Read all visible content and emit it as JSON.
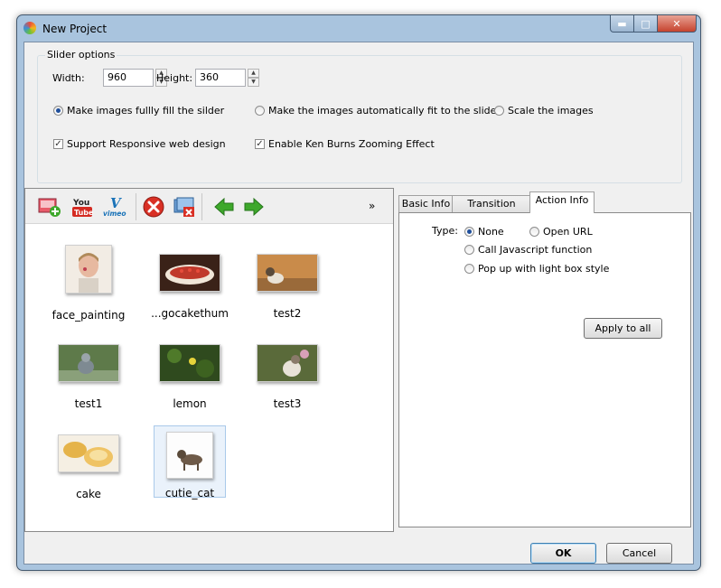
{
  "window": {
    "title": "New Project"
  },
  "slider_options": {
    "legend": "Slider options",
    "width_label": "Width:",
    "width_value": "960",
    "height_label": "Height:",
    "height_value": "360",
    "fill_modes": [
      {
        "label": "Make images fullly fill the silder",
        "selected": true
      },
      {
        "label": "Make the images automatically fit to the slider",
        "selected": false
      },
      {
        "label": "Scale the images",
        "selected": false
      }
    ],
    "responsive_label": "Support Responsive web design",
    "responsive_checked": true,
    "kenburns_label": "Enable Ken Burns Zooming Effect",
    "kenburns_checked": true
  },
  "toolbar": {
    "youtube_top": "You",
    "youtube_bottom": "Tube",
    "vimeo_label": "vimeo",
    "overflow_label": "»",
    "icons": [
      "add-image-icon",
      "youtube-icon",
      "vimeo-icon",
      "delete-icon",
      "remove-all-icon",
      "move-left-icon",
      "move-right-icon",
      "overflow-chevron-icon"
    ]
  },
  "images": [
    {
      "caption": "face_painting"
    },
    {
      "caption": "...gocakethum"
    },
    {
      "caption": "test2"
    },
    {
      "caption": "test1"
    },
    {
      "caption": "lemon"
    },
    {
      "caption": "test3"
    },
    {
      "caption": "cake"
    },
    {
      "caption": "cutie_cat"
    }
  ],
  "tabs": [
    {
      "label": "Basic Info"
    },
    {
      "label": "Transition Effect"
    },
    {
      "label": "Action Info"
    }
  ],
  "action_info": {
    "type_label": "Type:",
    "options": [
      {
        "label": "None",
        "selected": true
      },
      {
        "label": "Open URL",
        "selected": false
      },
      {
        "label": "Call Javascript function",
        "selected": false
      },
      {
        "label": "Pop up with light box style",
        "selected": false
      }
    ],
    "apply_all_label": "Apply to all"
  },
  "buttons": {
    "ok_label": "OK",
    "cancel_label": "Cancel"
  },
  "colors": {
    "title_bar": "#a9c4de",
    "close_button": "#c5432e",
    "delete_red": "#d93025",
    "arrow_green": "#3ea82b",
    "selection": "#eaf2fb"
  }
}
